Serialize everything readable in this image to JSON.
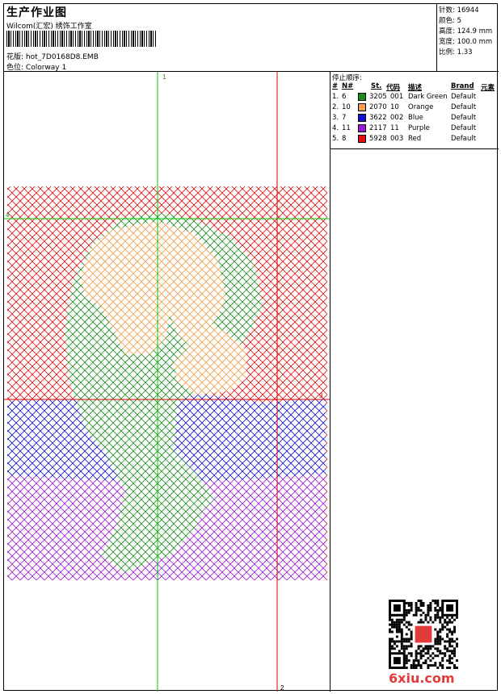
{
  "header": {
    "title": "生产作业图",
    "subtitle": "Wilcom(汇宏) 绣饰工作室",
    "design_label": "花版:",
    "design_value": "hot_7D0168D8.EMB",
    "colorway_label": "色位:",
    "colorway_value": "Colorway 1"
  },
  "specs": [
    {
      "label": "针数:",
      "value": "16944"
    },
    {
      "label": "颜色:",
      "value": "5"
    },
    {
      "label": "高度:",
      "value": "124.9 mm"
    },
    {
      "label": "宽度:",
      "value": "100.0 mm"
    },
    {
      "label": "比例:",
      "value": "1.33"
    }
  ],
  "stop_sequence": {
    "title": "停止顺序:",
    "headers": {
      "hash": "#",
      "no": "N#",
      "st": "St.",
      "code": "代码",
      "desc": "描述",
      "brand": "Brand",
      "element": "元素"
    },
    "rows": [
      {
        "idx": "1.",
        "no": "6",
        "color": "#1a8a1a",
        "st": "3205",
        "code": "001",
        "desc": "Dark Green",
        "brand": "Default"
      },
      {
        "idx": "2.",
        "no": "10",
        "color": "#f0a050",
        "st": "2070",
        "code": "10",
        "desc": "Orange",
        "brand": "Default"
      },
      {
        "idx": "3.",
        "no": "7",
        "color": "#1010d0",
        "st": "3622",
        "code": "002",
        "desc": "Blue",
        "brand": "Default"
      },
      {
        "idx": "4.",
        "no": "11",
        "color": "#9a1ad0",
        "st": "2117",
        "code": "11",
        "desc": "Purple",
        "brand": "Default"
      },
      {
        "idx": "5.",
        "no": "8",
        "color": "#e01010",
        "st": "5928",
        "code": "003",
        "desc": "Red",
        "brand": "Default"
      }
    ]
  },
  "guides": {
    "v1": "1",
    "v2": "2",
    "h3": "3",
    "h4": "4"
  },
  "watermark": "6xiu.com",
  "colors": {
    "green": "#1a8a1a",
    "orange": "#f0a050",
    "blue": "#1010d0",
    "purple": "#9a1ad0",
    "red": "#e01010",
    "guide_green": "#00cc00",
    "guide_red": "#dd0000"
  }
}
